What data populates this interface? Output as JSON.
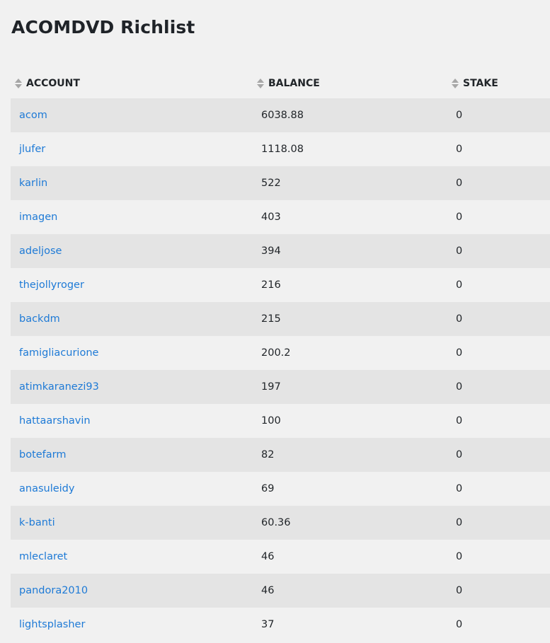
{
  "page": {
    "title": "ACOMDVD Richlist"
  },
  "table": {
    "headers": {
      "account": "ACCOUNT",
      "balance": "BALANCE",
      "stake": "STAKE"
    },
    "rows": [
      {
        "account": "acom",
        "balance": "6038.88",
        "stake": "0"
      },
      {
        "account": "jlufer",
        "balance": "1118.08",
        "stake": "0"
      },
      {
        "account": "karlin",
        "balance": "522",
        "stake": "0"
      },
      {
        "account": "imagen",
        "balance": "403",
        "stake": "0"
      },
      {
        "account": "adeljose",
        "balance": "394",
        "stake": "0"
      },
      {
        "account": "thejollyroger",
        "balance": "216",
        "stake": "0"
      },
      {
        "account": "backdm",
        "balance": "215",
        "stake": "0"
      },
      {
        "account": "famigliacurione",
        "balance": "200.2",
        "stake": "0"
      },
      {
        "account": "atimkaranezi93",
        "balance": "197",
        "stake": "0"
      },
      {
        "account": "hattaarshavin",
        "balance": "100",
        "stake": "0"
      },
      {
        "account": "botefarm",
        "balance": "82",
        "stake": "0"
      },
      {
        "account": "anasuleidy",
        "balance": "69",
        "stake": "0"
      },
      {
        "account": "k-banti",
        "balance": "60.36",
        "stake": "0"
      },
      {
        "account": "mleclaret",
        "balance": "46",
        "stake": "0"
      },
      {
        "account": "pandora2010",
        "balance": "46",
        "stake": "0"
      },
      {
        "account": "lightsplasher",
        "balance": "37",
        "stake": "0"
      }
    ]
  },
  "colors": {
    "link": "#1e7ad6",
    "row_striped": "#e4e4e4",
    "background": "#f1f1f1",
    "sort_icon": "#a7a7a7"
  },
  "icons": {
    "sort": "sort-icon"
  }
}
